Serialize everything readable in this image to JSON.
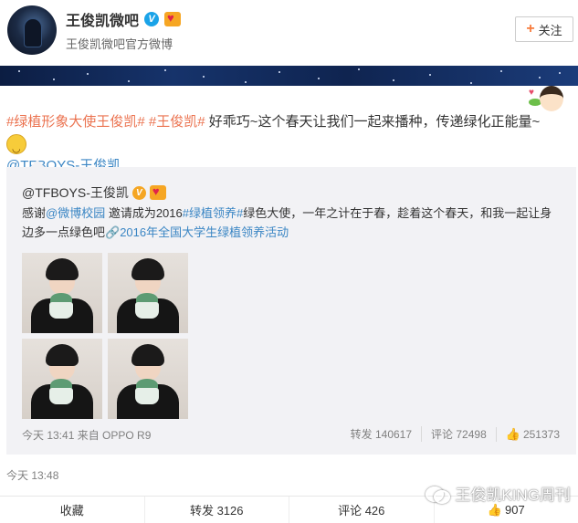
{
  "header": {
    "name": "王俊凯微吧",
    "verified_badge": "V",
    "subtitle": "王俊凯微吧官方微博",
    "follow_label": "关注"
  },
  "post": {
    "tag1": "#绿植形象大使王俊凯#",
    "tag2": "#王俊凯#",
    "text": " 好乖巧~这个春天让我们一起来播种，传递绿化正能量~",
    "mention": "@TFBOYS-王俊凯",
    "time": "今天 13:48"
  },
  "repost": {
    "author": "@TFBOYS-王俊凯",
    "verified_badge": "V",
    "text_part1": "感谢",
    "mention": "@微博校园",
    "text_part2": " 邀请成为2016",
    "tag": "#绿植领养#",
    "text_part3": "绿色大使，一年之计在于春，趁着这个春天，和我一起让身边多一点绿色吧",
    "link": "2016年全国大学生绿植领养活动",
    "meta": "今天 13:41 来自 OPPO R9",
    "stats": {
      "repost": "转发 140617",
      "comment": "评论 72498",
      "like": "251373"
    }
  },
  "actions": {
    "favorite": "收藏",
    "repost": "转发 3126",
    "comment": "评论 426",
    "like": "907"
  },
  "watermark": "王俊凯KING周刊",
  "colors": {
    "link_orange": "#eb7350",
    "link_blue": "#3b86c4",
    "verified_blue": "#1aa3e8",
    "verified_yellow": "#f5a623"
  }
}
